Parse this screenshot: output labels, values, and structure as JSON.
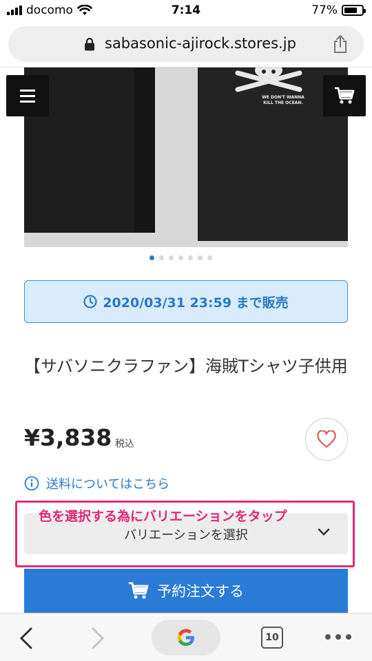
{
  "status_bar": {
    "carrier": "docomo",
    "time": "7:14",
    "battery": "77%",
    "battery_level": 0.77
  },
  "browser": {
    "url": "sabasonic-ajirock.stores.jp"
  },
  "product": {
    "image_text": "WE DON'T WANNA\nKILL THE OCEAN.",
    "carousel": {
      "count": 7,
      "active_index": 0
    },
    "sale_period": "2020/03/31 23:59 まで販売",
    "title": "【サバソニクラファン】海賊Tシャツ子供用",
    "price": "¥3,838",
    "tax_label": "税込",
    "shipping_link": "送料についてはこちら",
    "variation_select": "バリエーションを選択",
    "order_button": "予約注文する"
  },
  "annotation": {
    "text": "色を選択する為にバリエーションをタップ",
    "color": "#e0287a"
  },
  "toolbar": {
    "tab_count": "10"
  },
  "colors": {
    "accent": "#2a7bd6",
    "sale_bg": "#d9ecfb",
    "sale_text": "#2877c8",
    "heart": "#e0585a"
  },
  "icons": [
    "lock-icon",
    "share-icon",
    "menu-icon",
    "cart-icon",
    "clock-icon",
    "heart-icon",
    "info-icon",
    "chevron-down-icon",
    "back-icon",
    "forward-icon",
    "google-icon",
    "more-icon"
  ]
}
